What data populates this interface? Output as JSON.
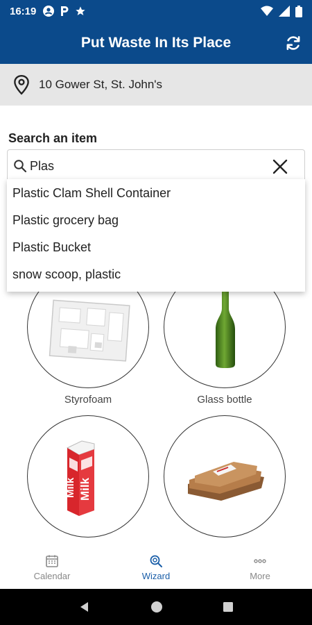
{
  "status_bar": {
    "time": "16:19"
  },
  "app_bar": {
    "title": "Put Waste In Its Place"
  },
  "location": {
    "address": "10 Gower St, St. John's"
  },
  "search": {
    "label": "Search an item",
    "value": "Plas",
    "suggestions": [
      "Plastic Clam Shell Container",
      "Plastic grocery bag",
      "Plastic Bucket",
      "snow scoop, plastic"
    ]
  },
  "items": [
    {
      "label": "Styrofoam"
    },
    {
      "label": "Glass bottle"
    },
    {
      "label": ""
    },
    {
      "label": ""
    }
  ],
  "bottom_nav": {
    "calendar": "Calendar",
    "wizard": "Wizard",
    "more": "More"
  },
  "colors": {
    "primary": "#0b4a8b",
    "active_nav": "#1a5ea8"
  }
}
